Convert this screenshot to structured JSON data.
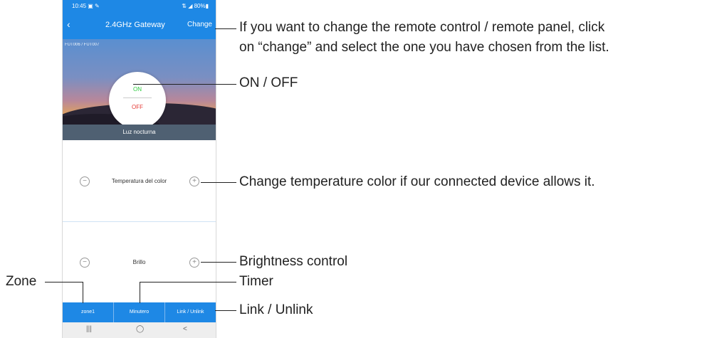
{
  "status_bar": {
    "time": "10:45 ▣ ✎",
    "system": "⇅ ◢ 80%▮"
  },
  "app_bar": {
    "back_icon": "chevron-left-icon",
    "title": "2.4GHz Gateway",
    "change_label": "Change"
  },
  "hero": {
    "subtitle": "FUT006 / FUT007",
    "on_label": "ON",
    "off_label": "OFF"
  },
  "mode_bar": {
    "label": "Luz nocturna"
  },
  "controls": {
    "color_temp": {
      "label": "Temperatura del color",
      "minus": "−",
      "plus": "+"
    },
    "brightness": {
      "label": "Brillo",
      "minus": "−",
      "plus": "+"
    }
  },
  "tabs": [
    "zone1",
    "Minutero",
    "Link / Unlink"
  ],
  "nav": {
    "recent": "|||",
    "home": "◯",
    "back": "<"
  },
  "annotations": {
    "change": "If you want to change the remote control / remote panel, click",
    "change2": "on “change” and select the one you have chosen from the list.",
    "onoff": "ON / OFF",
    "temp": "Change temperature color if our connected device allows it.",
    "brightness": "Brightness control",
    "timer": "Timer",
    "link": "Link / Unlink",
    "zone": "Zone"
  },
  "colors": {
    "accent": "#1e88e5",
    "on": "#2ecc40",
    "off": "#e53935",
    "mode_bar": "#4f6072"
  }
}
